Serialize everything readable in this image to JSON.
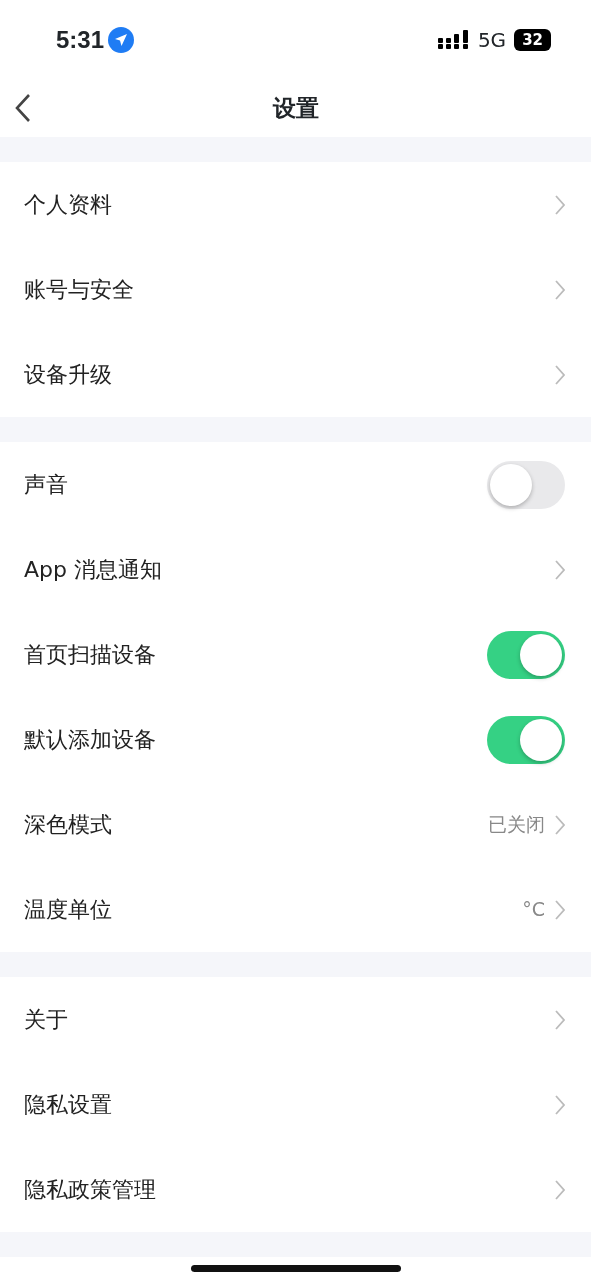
{
  "status_bar": {
    "time": "5:31",
    "network": "5G",
    "battery": "32"
  },
  "header": {
    "title": "设置"
  },
  "groups": [
    {
      "items": [
        {
          "kind": "link",
          "label": "个人资料"
        },
        {
          "kind": "link",
          "label": "账号与安全"
        },
        {
          "kind": "link",
          "label": "设备升级"
        }
      ]
    },
    {
      "items": [
        {
          "kind": "toggle",
          "label": "声音",
          "on": false
        },
        {
          "kind": "link",
          "label": "App 消息通知"
        },
        {
          "kind": "toggle",
          "label": "首页扫描设备",
          "on": true
        },
        {
          "kind": "toggle",
          "label": "默认添加设备",
          "on": true
        },
        {
          "kind": "link",
          "label": "深色模式",
          "value": "已关闭"
        },
        {
          "kind": "link",
          "label": "温度单位",
          "value": "°C"
        }
      ]
    },
    {
      "items": [
        {
          "kind": "link",
          "label": "关于"
        },
        {
          "kind": "link",
          "label": "隐私设置"
        },
        {
          "kind": "link",
          "label": "隐私政策管理"
        }
      ]
    }
  ]
}
